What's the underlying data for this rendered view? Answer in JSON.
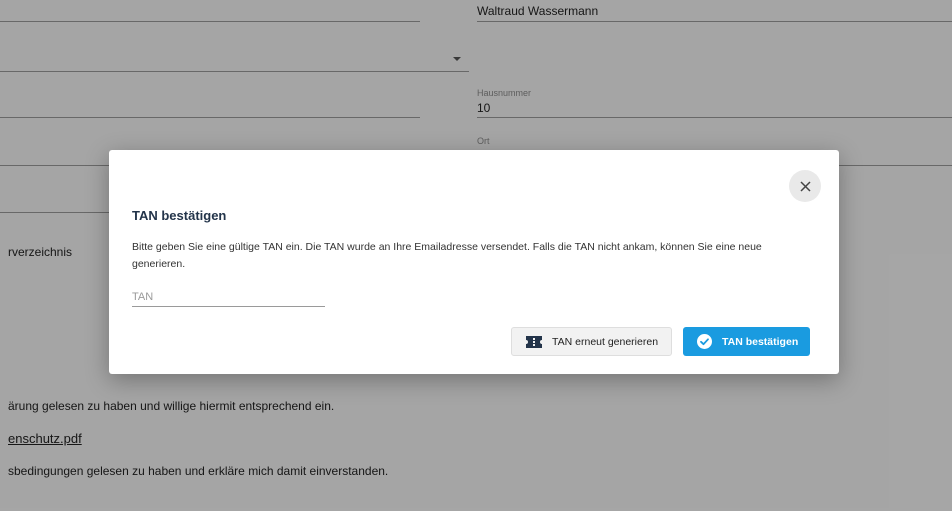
{
  "background": {
    "name_value": "Waltraud Wassermann",
    "hausnummer_label": "Hausnummer",
    "hausnummer_value": "10",
    "ort_label": "Ort",
    "verzeichnis_text": "rverzeichnis",
    "consent_text_1": "ärung gelesen zu haben und willige hiermit entsprechend ein.",
    "privacy_link": "enschutz.pdf",
    "consent_text_2": "sbedingungen gelesen zu haben und erkläre mich damit einverstanden."
  },
  "modal": {
    "title": "TAN bestätigen",
    "description": "Bitte geben Sie eine gültige TAN ein. Die TAN wurde an Ihre Emailadresse versendet. Falls die TAN nicht ankam, können Sie eine neue generieren.",
    "tan_placeholder": "TAN",
    "tan_value": "",
    "regenerate_label": "TAN erneut generieren",
    "confirm_label": "TAN bestätigen",
    "close_icon": "close-icon",
    "regenerate_icon": "ticket-icon",
    "confirm_icon": "check-circle-icon"
  },
  "colors": {
    "primary": "#1a9be0",
    "title": "#23344a",
    "overlay": "rgba(0,0,0,0.32)"
  }
}
